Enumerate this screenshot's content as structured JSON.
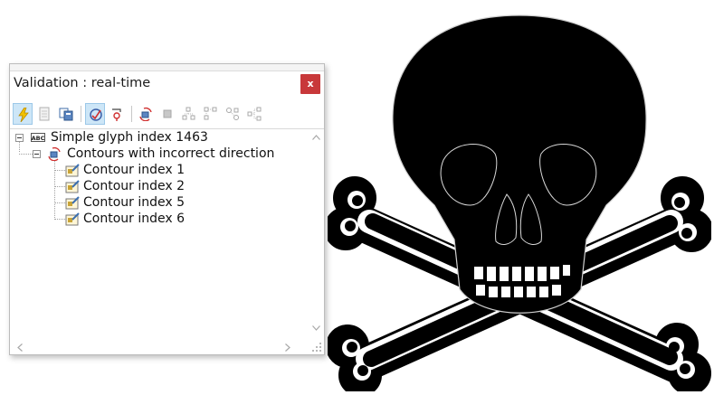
{
  "window": {
    "title": "Validation : real-time",
    "close_label": "x"
  },
  "toolbar": {
    "buttons": [
      {
        "icon": "lightning-icon",
        "active": true
      },
      {
        "icon": "document-icon",
        "active": false
      },
      {
        "icon": "copy-icon",
        "active": false
      },
      {
        "icon": "validate-glyph-icon",
        "active": true
      },
      {
        "icon": "point-icon",
        "active": false
      },
      {
        "icon": "reverse-direction-icon",
        "active": false
      },
      {
        "icon": "stop-icon",
        "active": false
      },
      {
        "icon": "node-tree-icon",
        "active": false
      },
      {
        "icon": "node-branch-icon",
        "active": false
      },
      {
        "icon": "node-link-icon",
        "active": false
      },
      {
        "icon": "node-group-icon",
        "active": false
      }
    ]
  },
  "tree": {
    "root": {
      "label": "Simple glyph index 1463",
      "icon": "glyph-abc-icon",
      "children": [
        {
          "label": "Contours with incorrect direction",
          "icon": "contour-direction-icon",
          "children": [
            {
              "label": "Contour index 1",
              "icon": "contour-edit-icon"
            },
            {
              "label": "Contour index 2",
              "icon": "contour-edit-icon"
            },
            {
              "label": "Contour index 5",
              "icon": "contour-edit-icon"
            },
            {
              "label": "Contour index 6",
              "icon": "contour-edit-icon"
            }
          ]
        }
      ]
    }
  },
  "colors": {
    "close_button": "#c8383a",
    "active_tool": "#cde6f7",
    "glyph_fill": "#000000"
  }
}
